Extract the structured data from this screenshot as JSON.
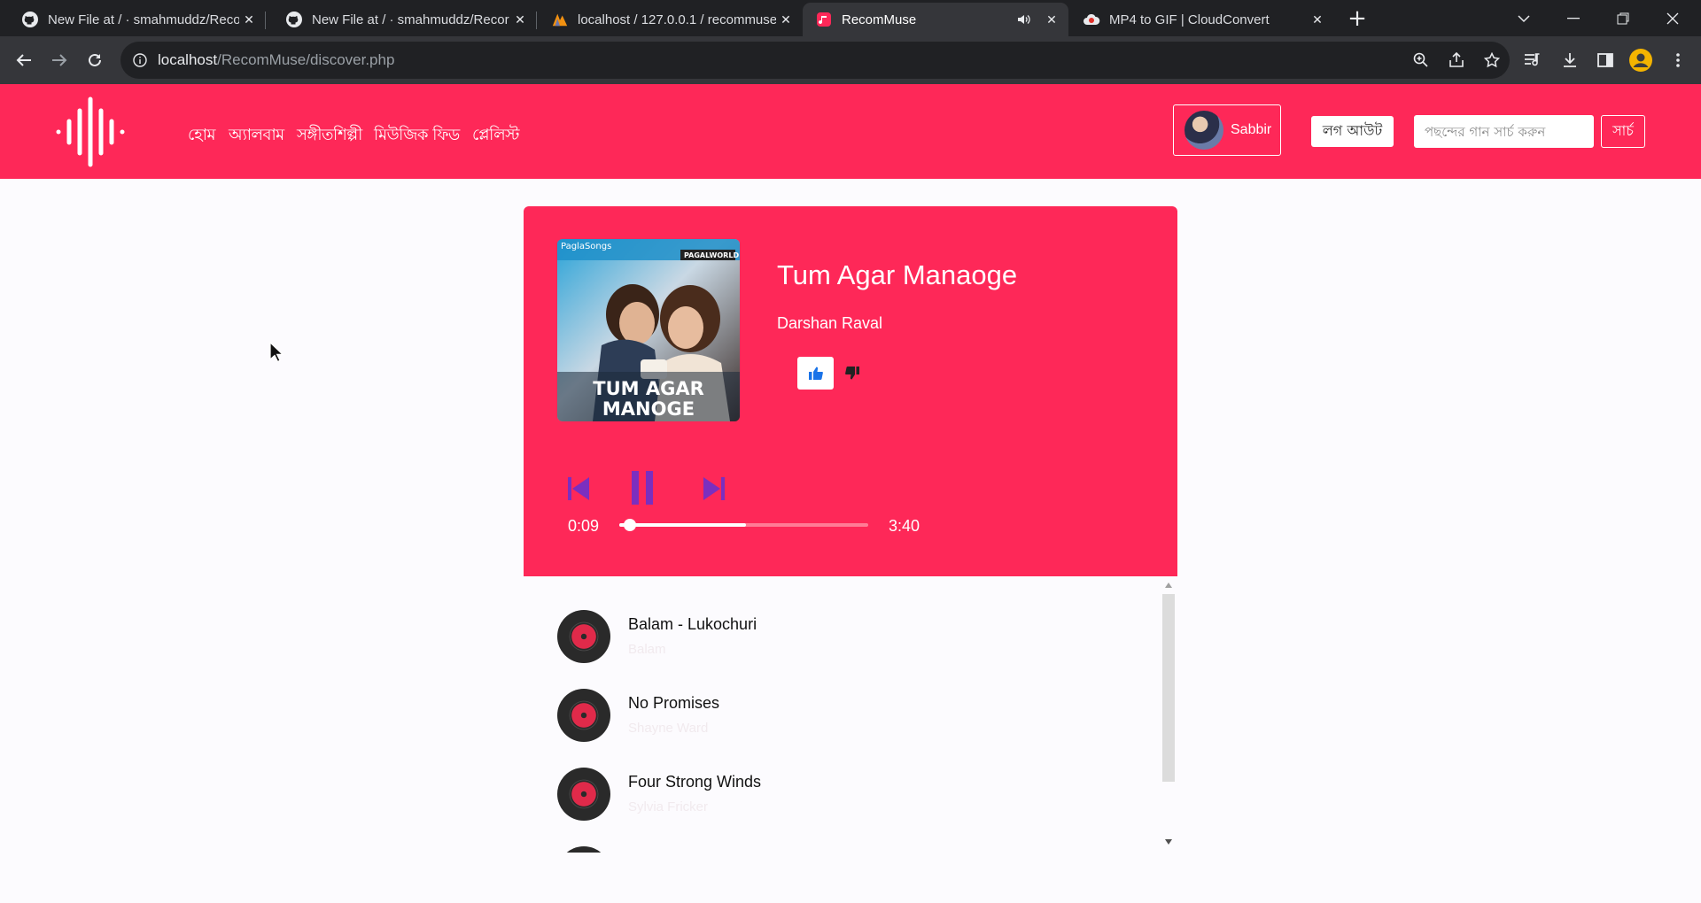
{
  "browser": {
    "tabs": [
      {
        "title": "New File at / · smahmuddz/Recor",
        "icon": "github-icon"
      },
      {
        "title": "New File at / · smahmuddz/Recor",
        "icon": "github-icon"
      },
      {
        "title": "localhost / 127.0.0.1 / recommuse",
        "icon": "phpmyadmin-icon"
      },
      {
        "title": "RecomMuse",
        "icon": "recommuse-icon",
        "active": true,
        "muted_icon": "speaker-icon"
      },
      {
        "title": "MP4 to GIF | CloudConvert",
        "icon": "cloudconvert-icon"
      }
    ],
    "url_host": "localhost",
    "url_path": "/RecomMuse/discover.php"
  },
  "site": {
    "accent_color": "#fe2858",
    "nav": [
      "হোম",
      "অ্যালবাম",
      "সঙ্গীতশিল্পী",
      "মিউজিক ফিড",
      "প্লেলিস্ট"
    ],
    "user_name": "Sabbir",
    "logout_label": "লগ আউট",
    "search_placeholder": "পছন্দের গান সার্চ করুন",
    "search_button": "সার্চ"
  },
  "player": {
    "cover_brand": "PaglaSongs",
    "cover_tag": "PAGALWORLD",
    "cover_title_line1": "TUM AGAR",
    "cover_title_line2": "MANOGE",
    "title": "Tum Agar Manaoge",
    "artist": "Darshan Raval",
    "current_time": "0:09",
    "duration": "3:40",
    "played_fraction": 0.041,
    "buffered_fraction": 0.51,
    "state": "playing"
  },
  "playlist": [
    {
      "name": "Balam - Lukochuri",
      "artist": "Balam"
    },
    {
      "name": "No Promises",
      "artist": "Shayne Ward"
    },
    {
      "name": "Four Strong Winds",
      "artist": "Sylvia Fricker"
    }
  ]
}
